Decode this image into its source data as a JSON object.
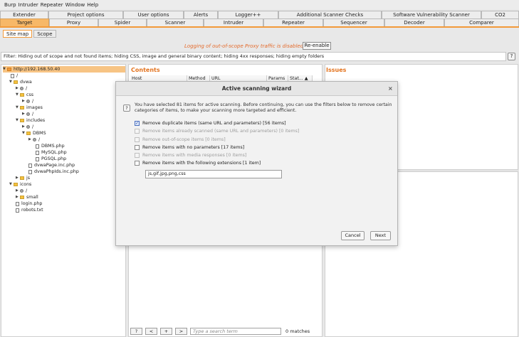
{
  "menubar": [
    "Burp",
    "Intruder",
    "Repeater",
    "Window",
    "Help"
  ],
  "tabs_row1": [
    "Extender",
    "Project options",
    "User options",
    "Alerts",
    "Logger++",
    "Additional Scanner Checks",
    "Software Vulnerability Scanner",
    "CO2"
  ],
  "tabs_row2": [
    "Target",
    "Proxy",
    "Spider",
    "Scanner",
    "Intruder",
    "Repeater",
    "Sequencer",
    "Decoder",
    "Comparer"
  ],
  "active_tab": "Target",
  "subtabs": [
    "Site map",
    "Scope"
  ],
  "notice": {
    "message": "Logging of out-of-scope Proxy traffic is disabled",
    "button": "Re-enable"
  },
  "filter": "Filter: Hiding out of scope and not found items;  hiding CSS, image and general binary content;  hiding 4xx responses;  hiding empty folders",
  "help_label": "?",
  "tree": [
    {
      "label": "http://192.168.50.40",
      "type": "host",
      "arrow": "▼"
    },
    {
      "label": "/",
      "type": "page",
      "arrow": ""
    },
    {
      "label": "dvwa",
      "type": "folder",
      "arrow": "▼"
    },
    {
      "label": "/",
      "type": "gear",
      "arrow": "▶"
    },
    {
      "label": "css",
      "type": "folder",
      "arrow": "▼"
    },
    {
      "label": "/",
      "type": "gear",
      "arrow": "▶"
    },
    {
      "label": "images",
      "type": "folder",
      "arrow": "▼"
    },
    {
      "label": "/",
      "type": "gear",
      "arrow": "▶"
    },
    {
      "label": "includes",
      "type": "folder",
      "arrow": "▼"
    },
    {
      "label": "/",
      "type": "gear",
      "arrow": "▶"
    },
    {
      "label": "DBMS",
      "type": "folder",
      "arrow": "▼"
    },
    {
      "label": "/",
      "type": "gear",
      "arrow": "▶"
    },
    {
      "label": "DBMS.php",
      "type": "page",
      "arrow": ""
    },
    {
      "label": "MySQL.php",
      "type": "page",
      "arrow": ""
    },
    {
      "label": "PGSQL.php",
      "type": "page",
      "arrow": ""
    },
    {
      "label": "dvwaPage.inc.php",
      "type": "page",
      "arrow": ""
    },
    {
      "label": "dvwaPhpIds.inc.php",
      "type": "page",
      "arrow": ""
    },
    {
      "label": "js",
      "type": "folder",
      "arrow": "▶"
    },
    {
      "label": "icons",
      "type": "folder",
      "arrow": "▼"
    },
    {
      "label": "/",
      "type": "gear",
      "arrow": "▶"
    },
    {
      "label": "small",
      "type": "folder",
      "arrow": "▶"
    },
    {
      "label": "login.php",
      "type": "page",
      "arrow": ""
    },
    {
      "label": "robots.txt",
      "type": "page",
      "arrow": ""
    }
  ],
  "contents": {
    "title": "Contents",
    "columns": [
      "Host",
      "Method",
      "URL",
      "Params",
      "Stat... ▲"
    ]
  },
  "issues": {
    "title": "Issues"
  },
  "bottombar": {
    "help": "?",
    "prev": "<",
    "add": "+",
    "next": ">",
    "search_placeholder": "Type a search term",
    "matches": "0 matches"
  },
  "dialog": {
    "title": "Active scanning wizard",
    "close": "×",
    "help": "?",
    "intro": "You have selected 81 items for active scanning. Before continuing, you can use the filters below to remove certain categories of items, to make your scanning more targeted and efficient.",
    "options": [
      {
        "label": "Remove duplicate items (same URL and parameters) [56 items]",
        "checked": true,
        "disabled": false
      },
      {
        "label": "Remove items already scanned (same URL and parameters) [0 items]",
        "checked": false,
        "disabled": true
      },
      {
        "label": "Remove out-of-scope items [0 items]",
        "checked": false,
        "disabled": true
      },
      {
        "label": "Remove items with no parameters [17 items]",
        "checked": false,
        "disabled": false
      },
      {
        "label": "Remove items with media responses [0 items]",
        "checked": false,
        "disabled": true
      },
      {
        "label": "Remove items with the following extensions [1 item]",
        "checked": false,
        "disabled": false
      }
    ],
    "extensions": "js,gif,jpg,png,css",
    "cancel": "Cancel",
    "next": "Next"
  },
  "colors": {
    "accent": "#f29a3a",
    "title": "#e3731e",
    "notice": "#e46b2c"
  }
}
